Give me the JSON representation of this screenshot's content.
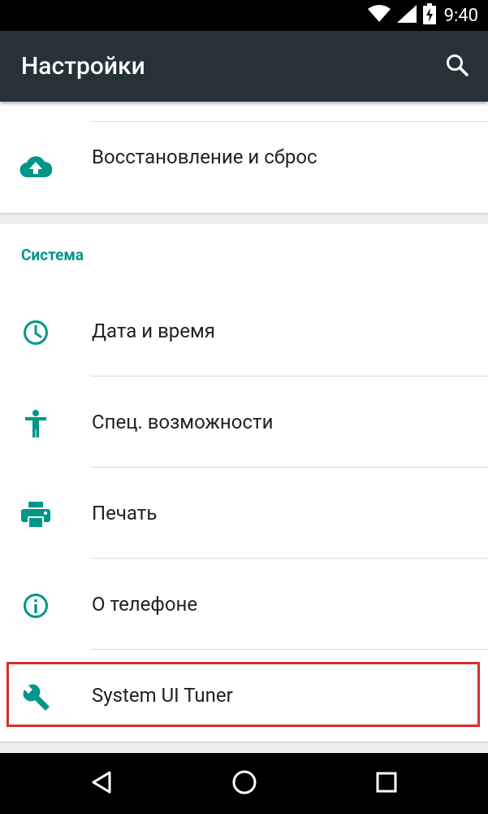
{
  "status_bar": {
    "time": "9:40",
    "icons": [
      "wifi-icon",
      "signal-icon",
      "battery-charging-icon"
    ]
  },
  "app_bar": {
    "title": "Настройки",
    "search_icon": "search-icon"
  },
  "card_top": {
    "items": [
      {
        "label": "Восстановление и сброс",
        "icon": "cloud-upload-icon"
      }
    ]
  },
  "system_section": {
    "header": "Система",
    "items": [
      {
        "label": "Дата и время",
        "icon": "clock-icon"
      },
      {
        "label": "Спец. возможности",
        "icon": "accessibility-icon"
      },
      {
        "label": "Печать",
        "icon": "printer-icon"
      },
      {
        "label": "О телефоне",
        "icon": "info-icon"
      },
      {
        "label": "System UI Tuner",
        "icon": "wrench-icon"
      }
    ]
  },
  "nav_bar": {
    "buttons": [
      "back-icon",
      "home-icon",
      "recents-icon"
    ]
  },
  "colors": {
    "accent": "#009688",
    "app_bar": "#263238",
    "highlight": "#d32f2f"
  }
}
